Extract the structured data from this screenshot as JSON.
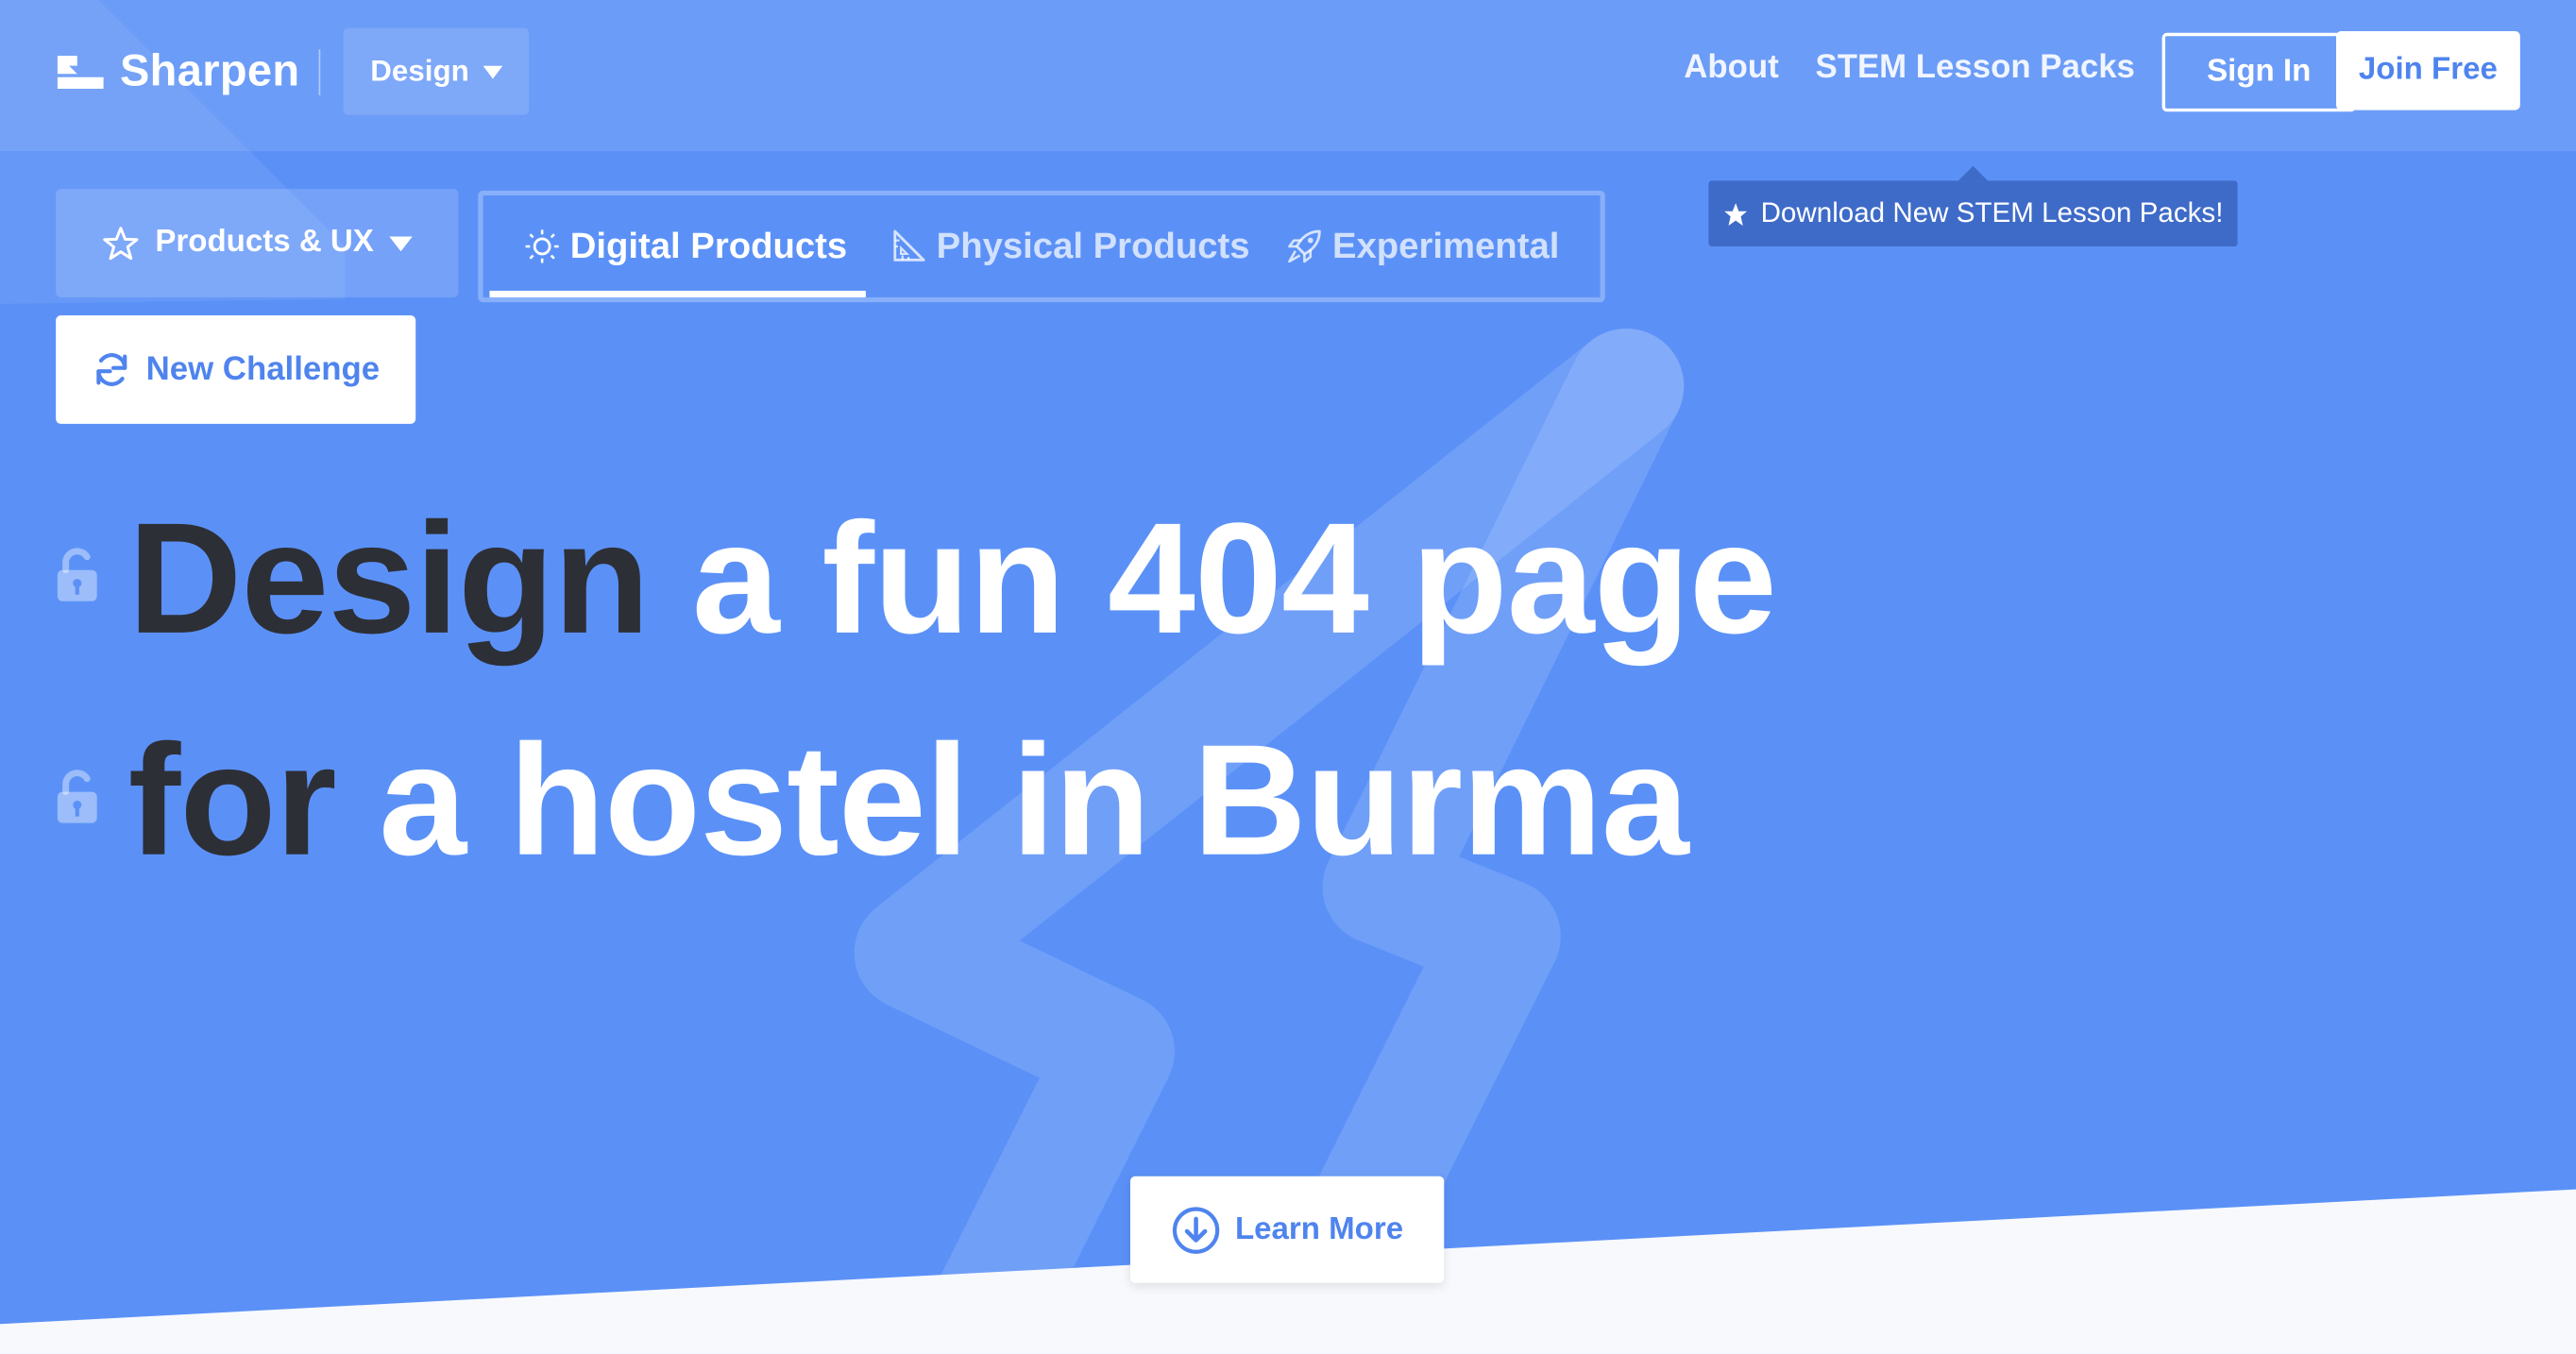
{
  "brand": {
    "name": "Sharpen"
  },
  "nav": {
    "category_dropdown": "Design",
    "links": [
      "About",
      "STEM Lesson Packs"
    ],
    "sign_in": "Sign In",
    "join_free": "Join Free"
  },
  "tooltip": {
    "text": "Download New STEM Lesson Packs!",
    "icon": "star-icon"
  },
  "filters": {
    "category_dropdown": "Products & UX",
    "tabs": [
      {
        "label": "Digital Products",
        "icon": "lightbulb-icon",
        "active": true
      },
      {
        "label": "Physical Products",
        "icon": "ruler-triangle-icon",
        "active": false
      },
      {
        "label": "Experimental",
        "icon": "rocket-icon",
        "active": false
      }
    ],
    "new_challenge": "New Challenge"
  },
  "prompt": {
    "line1": {
      "locked_word": "Design",
      "rest": "a fun 404 page"
    },
    "line2": {
      "locked_word": "for",
      "rest": "a hostel in Burma"
    }
  },
  "learn_more": "Learn More",
  "colors": {
    "hero_bg": "#5b91f7",
    "accent": "#4f84ee",
    "dark_text": "#2d2f36",
    "tooltip_bg": "#3e6bc8",
    "page_bg": "#f7f9fd"
  }
}
